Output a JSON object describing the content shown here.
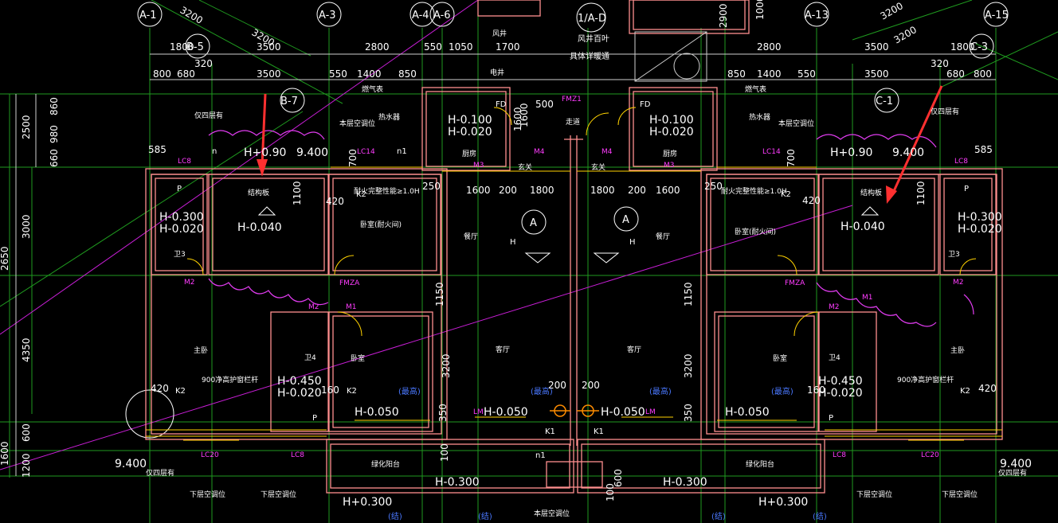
{
  "colors": {
    "background": "#000000",
    "grid": "#1f9a1f",
    "wall": "#ff8f8f",
    "dim": "#cfcfcf",
    "magenta": "#ff3cff",
    "cyan": "#33e0ff",
    "yellow": "#ffd200",
    "white": "#ffffff",
    "blue": "#4a78ff",
    "arrow": "#ff3030"
  },
  "axes_top": [
    "A-1",
    "A-3",
    "A-4",
    "A-6",
    "1/A-D",
    "A-13",
    "A-15"
  ],
  "axes_mid": [
    "B-5",
    "B-7",
    "C-1",
    "C-3"
  ],
  "dims": {
    "row_top": [
      "3200",
      "3200",
      "1000",
      "3200",
      "3200"
    ],
    "row1": [
      "1800",
      "3500",
      "2800",
      "550",
      "1050",
      "1700",
      "2800",
      "3500",
      "1800"
    ],
    "row2": [
      "320",
      "320"
    ],
    "row3": [
      "800",
      "680",
      "3500",
      "550",
      "1400",
      "850",
      "850",
      "1400",
      "550",
      "3500",
      "680",
      "800"
    ],
    "inner": [
      "500",
      "1600",
      "250",
      "1600",
      "200",
      "1800",
      "1800",
      "200",
      "1600",
      "250",
      "1100",
      "1100",
      "420",
      "420",
      "1150",
      "1150",
      "3200",
      "3200",
      "200",
      "200",
      "350",
      "350",
      "160",
      "160",
      "100",
      "100",
      "600",
      "2900",
      "1600",
      "700",
      "700",
      "585",
      "585",
      "420",
      "420"
    ],
    "left_vertical": [
      "860",
      "2500",
      "980",
      "660",
      "3000",
      "2650",
      "4350",
      "600",
      "1200",
      "1600"
    ]
  },
  "elevations": {
    "e1": "H+0.90",
    "e2": "9.400",
    "e3": "H+0.90",
    "e4": "9.400",
    "e5": "H-0.300",
    "e6": "H-0.020",
    "e7": "H-0.040",
    "e8": "H-0.040",
    "e9": "H-0.300",
    "e10": "H-0.020",
    "e11": "H-0.100",
    "e12": "H-0.020",
    "e13": "H-0.100",
    "e14": "H-0.020",
    "e15": "H-0.450",
    "e16": "H-0.020",
    "e17": "H-0.450",
    "e18": "H-0.020",
    "e19": "H-0.050",
    "e20": "H-0.050",
    "e21": "H-0.050",
    "e22": "H-0.050",
    "e23": "H-0.300",
    "e24": "H-0.300",
    "e25": "H+0.300",
    "e26": "H+0.300",
    "e27": "9.400",
    "e28": "9.400"
  },
  "rooms": {
    "living_l": "客厅",
    "living_r": "客厅",
    "dining_l": "餐厅",
    "dining_r": "餐厅",
    "master_l": "主卧",
    "master_r": "主卧",
    "bed_l": "卧室",
    "bed_r": "卧室",
    "bed_fire_l": "卧室(耐火间)",
    "bed_fire_r": "卧室(耐火间)",
    "kitchen_l": "厨房",
    "kitchen_r": "厨房",
    "bath_l": "卫4",
    "bath_r": "卫4",
    "bath3_l": "卫3",
    "bath3_r": "卫3",
    "balcony_l": "绿化阳台",
    "balcony_r": "绿化阳台",
    "corridor": "走道",
    "hall_l": "玄关",
    "hall_r": "玄关",
    "shaft": "风井",
    "elec": "电井",
    "struct_l": "结构板",
    "struct_r": "结构板",
    "heater_l": "热水器",
    "heater_r": "热水器",
    "ac_top_l": "本层空调位",
    "ac_top_r": "本层空调位",
    "gas_l": "燃气表",
    "gas_r": "燃气表",
    "roof_l": "仅四层有",
    "roof_r": "仅四层有",
    "roof_l2": "仅四层有",
    "roof_r2": "仅四层有",
    "rail_l": "900净高护窗栏杆",
    "rail_r": "900净高护窗栏杆",
    "ac_low1": "下层空调位",
    "ac_low2": "下层空调位",
    "ac_low3": "下层空调位",
    "ac_low4": "下层空调位",
    "ac_bottom": "本层空调位",
    "fire_l": "耐火完整性能≥1.0H",
    "fire_r": "耐火完整性能≥1.0H",
    "louver1": "风井百叶",
    "louver2": "具体详暖通",
    "highest": "(最高)",
    "struct_mark": "(结)"
  },
  "tags": {
    "LC8": "LC8",
    "LC8b": "LC8",
    "LC8c": "LC8",
    "LC8d": "LC8",
    "LC14": "LC14",
    "LC20": "LC20",
    "LC20b": "LC20",
    "M1": "M1",
    "M2": "M2",
    "M3": "M3",
    "M4": "M4",
    "FMZ1": "FMZ1",
    "FMZA": "FMZA",
    "FD": "FD",
    "K1": "K1",
    "K2": "K2",
    "P": "P",
    "A": "A",
    "H": "H",
    "n1": "n1",
    "n": "n",
    "LM": "LM"
  }
}
